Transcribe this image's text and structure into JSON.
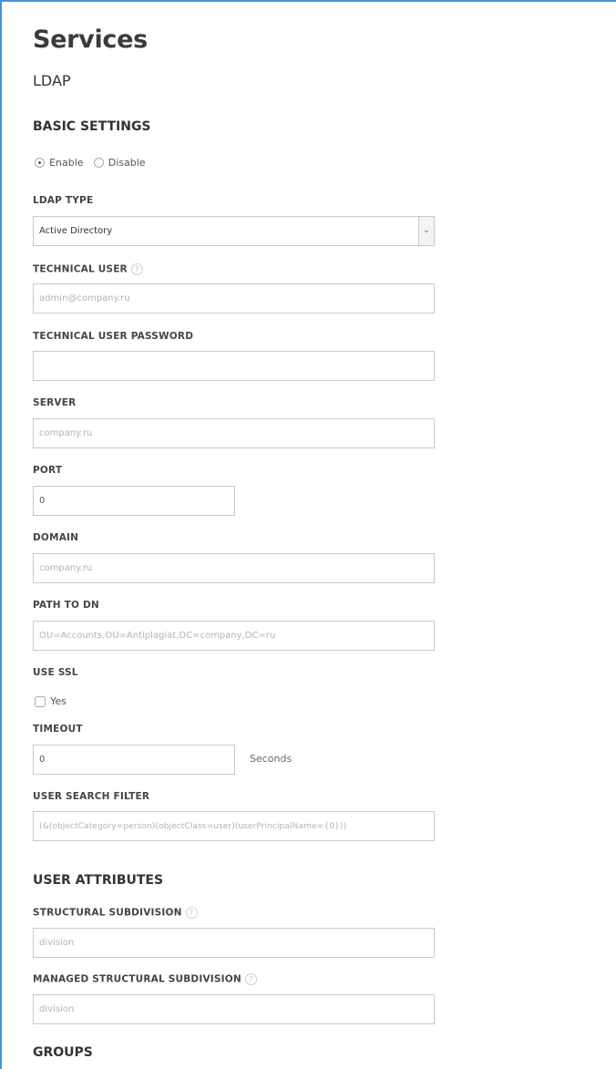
{
  "page": {
    "title": "Services",
    "subtitle": "LDAP"
  },
  "basic_settings": {
    "heading": "BASIC SETTINGS",
    "enable_label": "Enable",
    "disable_label": "Disable",
    "selected": "Enable"
  },
  "ldap_type": {
    "label": "LDAP TYPE",
    "value": "Active Directory"
  },
  "technical_user": {
    "label": "TECHNICAL USER",
    "placeholder": "admin@company.ru"
  },
  "technical_user_password": {
    "label": "TECHNICAL USER PASSWORD",
    "value": ""
  },
  "server": {
    "label": "SERVER",
    "placeholder": "company.ru"
  },
  "port": {
    "label": "PORT",
    "value": "0"
  },
  "domain": {
    "label": "DOMAIN",
    "placeholder": "company.ru"
  },
  "path_to_dn": {
    "label": "PATH TO DN",
    "placeholder": "OU=Accounts,OU=Antiplagiat,DC=company,DC=ru"
  },
  "use_ssl": {
    "label": "USE SSL",
    "option_label": "Yes",
    "checked": false
  },
  "timeout": {
    "label": "TIMEOUT",
    "value": "0",
    "unit": "Seconds"
  },
  "user_search_filter": {
    "label": "USER SEARCH FILTER",
    "placeholder": "(&(objectCategory=person)(objectClass=user)(userPrincipalName={0}))"
  },
  "user_attributes": {
    "heading": "USER ATTRIBUTES",
    "structural_subdivision": {
      "label": "STRUCTURAL SUBDIVISION",
      "placeholder": "division"
    },
    "managed_structural_subdivision": {
      "label": "MANAGED STRUCTURAL SUBDIVISION",
      "placeholder": "division"
    }
  },
  "groups": {
    "heading": "GROUPS"
  },
  "icons": {
    "help": "question-circle-icon",
    "dropdown": "chevron-down-icon"
  },
  "colors": {
    "accent_border": "#4a90d9",
    "input_border": "#c8c8c8",
    "placeholder": "#b3b3b3"
  }
}
